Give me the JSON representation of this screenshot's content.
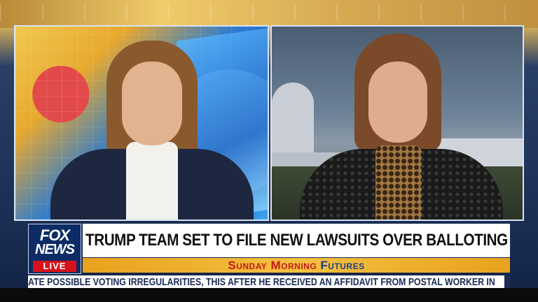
{
  "network": {
    "logo_line1": "FOX",
    "logo_line2": "NEWS",
    "live_label": "LIVE"
  },
  "lower_third": {
    "headline": "TRUMP TEAM SET TO FILE NEW LAWSUITS OVER BALLOTING",
    "show_name_part1": "Sunday Morning",
    "show_name_part2": "Futures"
  },
  "ticker": {
    "text": "ATE POSSIBLE VOTING IRREGULARITIES, THIS AFTER HE RECEIVED AN AFFIDAVIT FROM POSTAL WORKER IN"
  },
  "colors": {
    "headline_bg": "#ffffff",
    "show_bar": "#f4c040",
    "live_red": "#d8121a",
    "logo_blue": "#0d2c66"
  }
}
